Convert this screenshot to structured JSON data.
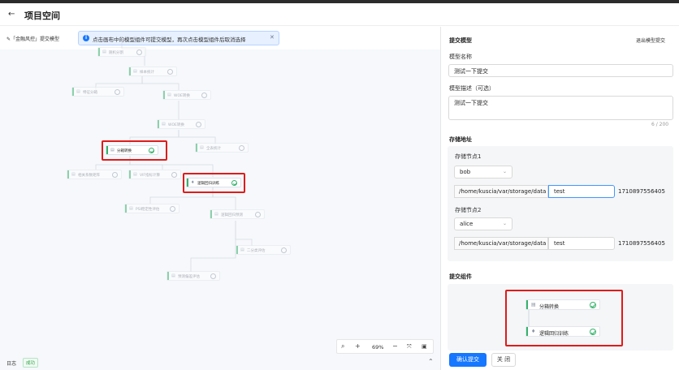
{
  "header": {
    "back_icon": "arrow-left-icon",
    "title": "项目空间"
  },
  "canvas": {
    "mode_label": "✎「金融风控」提交模型",
    "banner": {
      "icon": "info-icon",
      "text": "点击画布中的模型组件可提交模型，再次点击模型组件后取消选择",
      "close_icon": "close-icon"
    },
    "nodes": [
      {
        "label": "随机分割",
        "active": false
      },
      {
        "label": "样本统计",
        "active": false
      },
      {
        "label": "特征分箱",
        "active": false
      },
      {
        "label": "WOE转换",
        "active": false
      },
      {
        "label": "分箱转换",
        "active": true
      },
      {
        "label": "全表统计",
        "active": false
      },
      {
        "label": "相关系数矩阵",
        "active": false
      },
      {
        "label": "VIF指标计算",
        "active": false
      },
      {
        "label": "逻辑回归训练",
        "active": true
      },
      {
        "label": "PSI稳定性评估",
        "active": false
      },
      {
        "label": "逻辑回归预测",
        "active": false
      },
      {
        "label": "二分类评估",
        "active": false
      },
      {
        "label": "预测偏差评估",
        "active": false
      }
    ],
    "zoom": {
      "zoom_in_icon": "search-icon",
      "plus_icon": "plus-icon",
      "value": "69%",
      "minus_icon": "minus-icon",
      "fit_icon": "fit-view-icon",
      "minimap_icon": "minimap-icon"
    },
    "footer": {
      "log_label": "日志",
      "status": "成功",
      "collapse_icon": "chevron-up-icon"
    }
  },
  "panel": {
    "title": "提交模型",
    "exit_label": "退出模型提交",
    "model_name": {
      "label": "模型名称",
      "value": "测试一下提交"
    },
    "model_desc": {
      "label": "模型描述（可选）",
      "value": "测试一下提交",
      "counter": "6 / 200"
    },
    "storage": {
      "title": "存储地址",
      "nodes": [
        {
          "label": "存储节点1",
          "party": "bob",
          "path_prefix": "/home/kuscia/var/storage/data",
          "path_value": "test",
          "suffix": "1710897556405"
        },
        {
          "label": "存储节点2",
          "party": "alice",
          "path_prefix": "/home/kuscia/var/storage/data",
          "path_value": "test",
          "suffix": "1710897556405"
        }
      ]
    },
    "components": {
      "title": "提交组件",
      "items": [
        {
          "label": "分箱转换",
          "icon": "table-icon"
        },
        {
          "label": "逻辑回归训练",
          "icon": "bulb-icon"
        }
      ]
    },
    "confirm_label": "确认提交",
    "close_label": "关 闭"
  },
  "colors": {
    "primary": "#1677ff",
    "success": "#34b36b",
    "highlight": "#e01b1b"
  }
}
